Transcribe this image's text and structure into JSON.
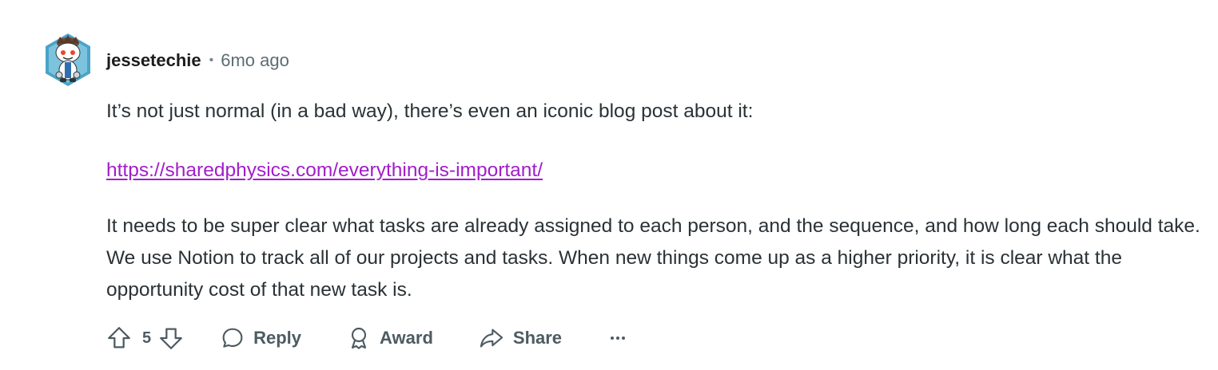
{
  "comment": {
    "author": "jessetechie",
    "separator": "•",
    "time_ago": "6mo ago",
    "avatar_icon": "snoo-avatar-icon",
    "body": {
      "paragraph_1": "It’s not just normal (in a bad way), there’s even an iconic blog post about it:",
      "link_text": "https://sharedphysics.com/everything-is-important/",
      "paragraph_3": "It needs to be super clear what tasks are already assigned to each person, and the sequence, and how long each should take. We use Notion to track all of our projects and tasks. When new things come up as a higher priority, it is clear what the opportunity cost of that new task is."
    },
    "actions": {
      "upvote_icon": "upvote-arrow-icon",
      "score": "5",
      "downvote_icon": "downvote-arrow-icon",
      "reply_label": "Reply",
      "reply_icon": "speech-bubble-icon",
      "award_label": "Award",
      "award_icon": "award-ribbon-icon",
      "share_label": "Share",
      "share_icon": "share-arrow-icon",
      "more_icon": "ellipsis-icon"
    }
  },
  "colors": {
    "text": "#2a3236",
    "meta": "#5c6c74",
    "link": "#a11ec9",
    "action": "#4d5b62"
  }
}
